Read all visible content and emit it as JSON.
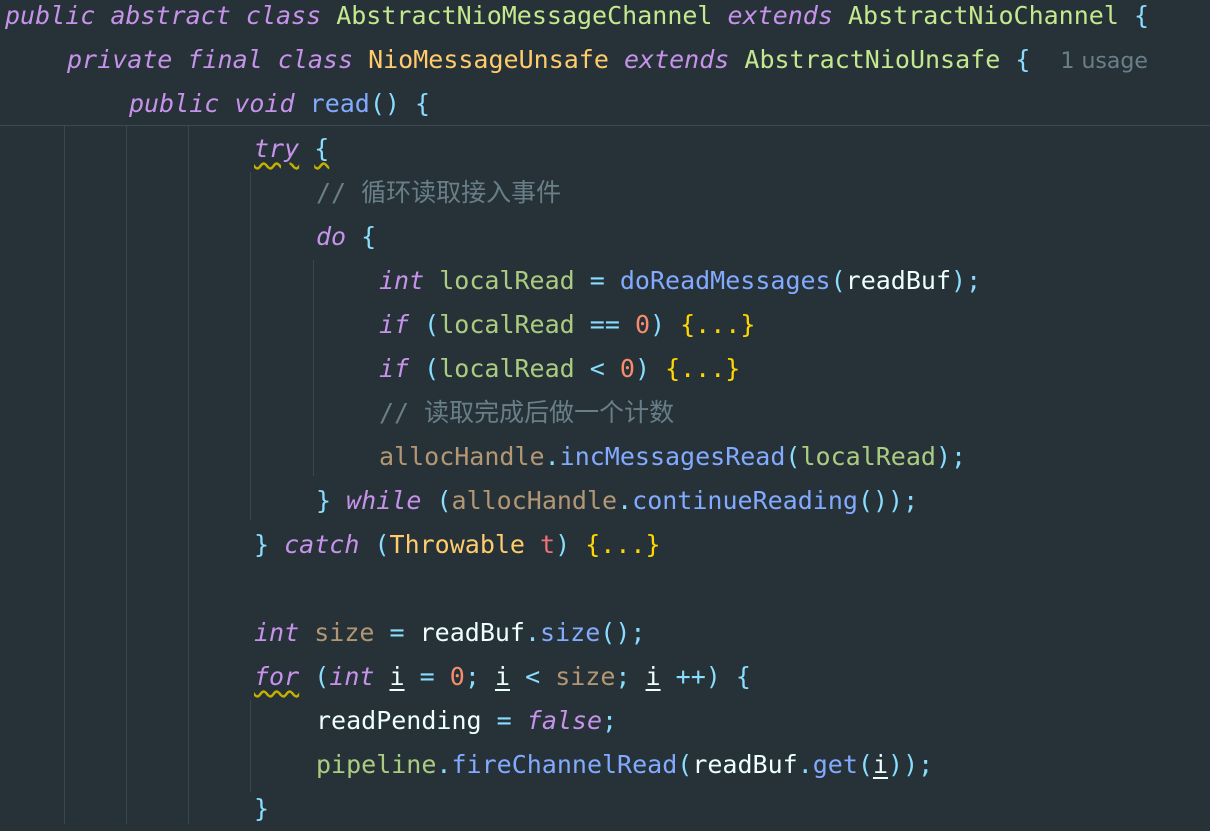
{
  "editor": {
    "header_lines": [
      {
        "id": "class-decl",
        "tokens": [
          "public",
          "abstract",
          "class",
          "AbstractNioMessageChannel",
          "extends",
          "AbstractNioChannel",
          "{"
        ]
      },
      {
        "id": "inner-class-decl",
        "tokens": [
          "private",
          "final",
          "class",
          "NioMessageUnsafe",
          "extends",
          "AbstractNioUnsafe",
          "{"
        ],
        "hint": "1 usage"
      },
      {
        "id": "method-decl",
        "tokens": [
          "public",
          "void",
          "read",
          "()",
          "{"
        ]
      }
    ],
    "body": {
      "try_kw": "try",
      "open_brace": "{",
      "comment_1": "// 循环读取接入事件",
      "do_kw": "do",
      "int_kw": "int",
      "localRead": "localRead",
      "assign": "=",
      "doReadMessages": "doReadMessages",
      "readBuf": "readBuf",
      "if_kw": "if",
      "eq": "==",
      "lt": "<",
      "zero": "0",
      "fold": "{...}",
      "comment_2": "// 读取完成后做一个计数",
      "allocHandle": "allocHandle",
      "incMessagesRead": "incMessagesRead",
      "close_brace": "}",
      "while_kw": "while",
      "continueReading": "continueReading",
      "catch_kw": "catch",
      "throwable": "Throwable",
      "t_param": "t",
      "size_var": "size",
      "size_fn": "size",
      "for_kw": "for",
      "i_var": "i",
      "incr": "++",
      "readPending": "readPending",
      "false_kw": "false",
      "pipeline": "pipeline",
      "fireChannelRead": "fireChannelRead",
      "get_fn": "get"
    }
  },
  "colors": {
    "background": "#263238",
    "keyword": "#c792ea",
    "class": "#ffcb6b",
    "function": "#82aaff",
    "number": "#f78c6c",
    "comment": "#697e87"
  }
}
